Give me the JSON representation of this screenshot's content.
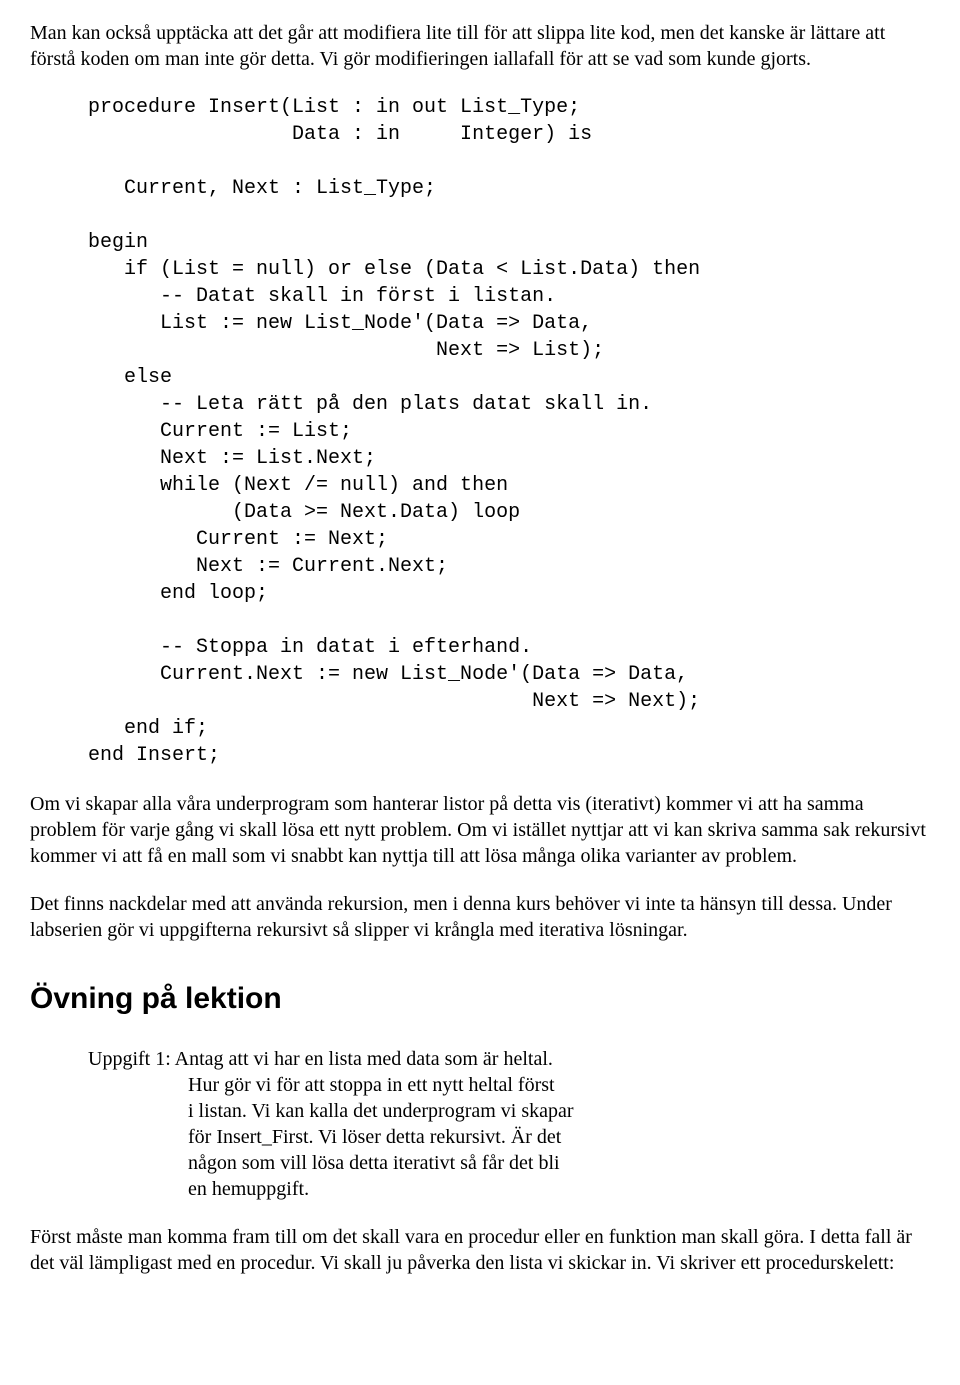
{
  "p1": "Man kan också upptäcka att det går att modifiera lite till för att slippa lite kod, men det kanske är lättare att förstå koden om man inte gör detta. Vi gör modifieringen iallafall för att se vad som kunde gjorts.",
  "code": "procedure Insert(List : in out List_Type;\n                 Data : in     Integer) is\n\n   Current, Next : List_Type;\n\nbegin\n   if (List = null) or else (Data < List.Data) then\n      -- Datat skall in först i listan.\n      List := new List_Node'(Data => Data,\n                             Next => List);\n   else\n      -- Leta rätt på den plats datat skall in.\n      Current := List;\n      Next := List.Next;\n      while (Next /= null) and then\n            (Data >= Next.Data) loop\n         Current := Next;\n         Next := Current.Next;\n      end loop;\n\n      -- Stoppa in datat i efterhand.\n      Current.Next := new List_Node'(Data => Data,\n                                     Next => Next);\n   end if;\nend Insert;",
  "p2": "Om vi skapar alla våra underprogram som hanterar listor på detta vis (iterativt) kommer vi att ha samma problem för varje gång vi skall lösa ett nytt problem. Om vi istället nyttjar att vi kan skriva samma sak rekursivt kommer vi att få en mall som vi snabbt kan nyttja till att lösa många olika varianter av problem.",
  "p3": "Det finns nackdelar med att använda rekursion, men i denna kurs behöver vi inte ta hänsyn till dessa. Under labserien gör vi uppgifterna rekursivt så slipper vi krångla med iterativa lösningar.",
  "heading": "Övning på lektion",
  "exercise": {
    "l1": "Uppgift 1: Antag att vi har en lista med data som är heltal.",
    "l2": "Hur gör vi för att stoppa in ett nytt heltal först",
    "l3": "i listan. Vi kan kalla det underprogram vi skapar",
    "l4": "för Insert_First. Vi löser detta rekursivt. Är det",
    "l5": "någon som vill lösa detta iterativt så får det bli",
    "l6": "en hemuppgift."
  },
  "p4": "Först måste man komma fram till om det skall vara en procedur eller en funktion man skall göra. I detta fall är det väl lämpligast med en procedur. Vi skall ju påverka den lista vi skickar in. Vi skriver ett procedurskelett:"
}
